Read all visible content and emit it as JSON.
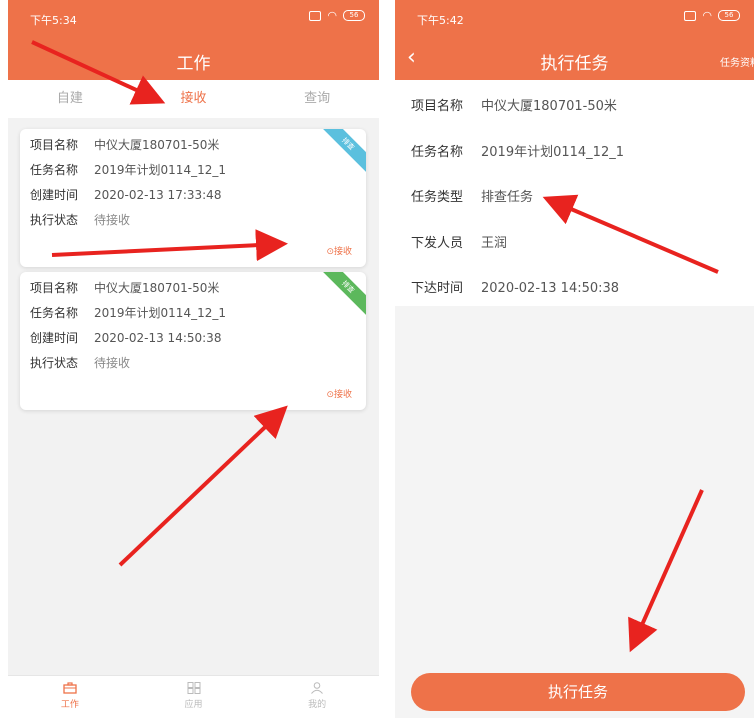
{
  "left": {
    "status_time": "下午5:34",
    "battery": "56",
    "title": "工作",
    "tabs": [
      "自建",
      "接收",
      "查询"
    ],
    "cards": [
      {
        "fields": [
          {
            "label": "项目名称",
            "value": "中仪大厦180701-50米"
          },
          {
            "label": "任务名称",
            "value": "2019年计划0114_12_1"
          },
          {
            "label": "创建时间",
            "value": "2020-02-13 17:33:48"
          },
          {
            "label": "执行状态",
            "value": "待接收"
          }
        ],
        "ribbon": "排查",
        "action": "⊙接收"
      },
      {
        "fields": [
          {
            "label": "项目名称",
            "value": "中仪大厦180701-50米"
          },
          {
            "label": "任务名称",
            "value": "2019年计划0114_12_1"
          },
          {
            "label": "创建时间",
            "value": "2020-02-13 14:50:38"
          },
          {
            "label": "执行状态",
            "value": "待接收"
          }
        ],
        "ribbon": "排查",
        "action": "⊙接收"
      }
    ],
    "nav": [
      "工作",
      "应用",
      "我的"
    ]
  },
  "right": {
    "status_time": "下午5:42",
    "battery": "56",
    "title": "执行任务",
    "right_link": "任务资料",
    "fields": [
      {
        "label": "项目名称",
        "value": "中仪大厦180701-50米"
      },
      {
        "label": "任务名称",
        "value": "2019年计划0114_12_1"
      },
      {
        "label": "任务类型",
        "value": "排查任务"
      },
      {
        "label": "下发人员",
        "value": "王润"
      },
      {
        "label": "下达时间",
        "value": "2020-02-13 14:50:38"
      }
    ],
    "button": "执行任务"
  },
  "colors": {
    "accent": "#ee7249",
    "ribbon_blue": "#5bc0de",
    "ribbon_green": "#5cb85c",
    "arrow": "#e8231f"
  },
  "icons": {
    "back": "chevron-left-icon",
    "nav": [
      "briefcase-icon",
      "apps-grid-icon",
      "person-icon"
    ]
  }
}
